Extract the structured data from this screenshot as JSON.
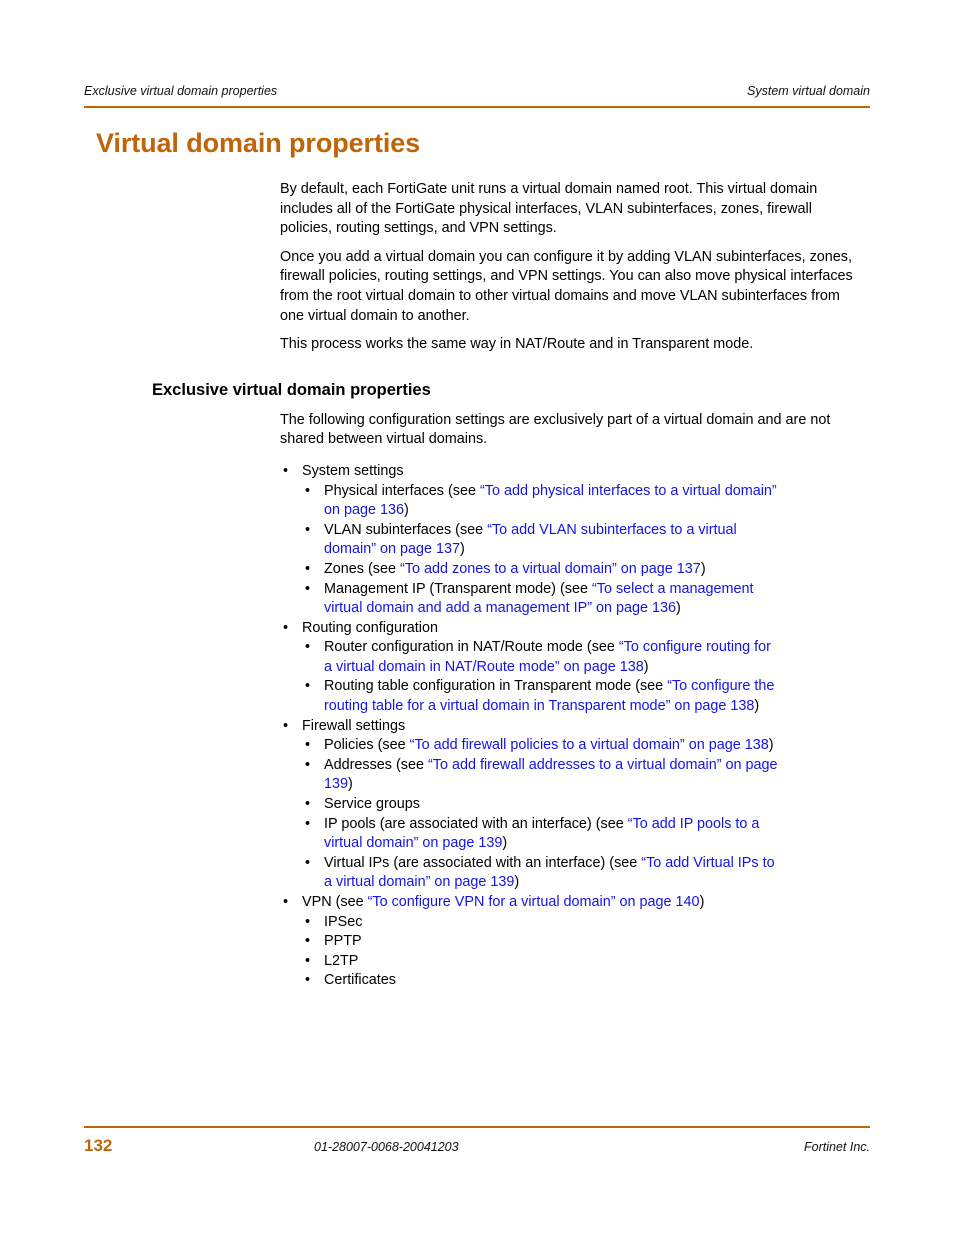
{
  "header": {
    "left": "Exclusive virtual domain properties",
    "right": "System virtual domain"
  },
  "title": "Virtual domain properties",
  "intro_paragraphs": [
    "By default, each FortiGate unit runs a virtual domain named root. This virtual domain includes all of the FortiGate physical interfaces, VLAN subinterfaces, zones, firewall policies, routing settings, and VPN settings.",
    "Once you add a virtual domain you can configure it by adding VLAN subinterfaces, zones, firewall policies, routing settings, and VPN settings. You can also move physical interfaces from the root virtual domain to other virtual domains and move VLAN subinterfaces from one virtual domain to another.",
    "This process works the same way in NAT/Route and in Transparent mode."
  ],
  "section": {
    "heading": "Exclusive virtual domain properties",
    "lead": "The following configuration settings are exclusively part of a virtual domain and are not shared between virtual domains.",
    "bullet_char": "•",
    "groups": [
      {
        "label": "System settings",
        "items": [
          {
            "pre": "Physical interfaces (see ",
            "link": "“To add physical interfaces to a virtual domain” on page 136",
            "post": ")"
          },
          {
            "pre": "VLAN subinterfaces (see ",
            "link": "“To add VLAN subinterfaces to a virtual domain” on page 137",
            "post": ")"
          },
          {
            "pre": "Zones (see ",
            "link": "“To add zones to a virtual domain” on page 137",
            "post": ")"
          },
          {
            "pre": "Management IP (Transparent mode) (see ",
            "link": "“To select a management virtual domain and add a management IP” on page 136",
            "post": ")"
          }
        ]
      },
      {
        "label": "Routing configuration",
        "items": [
          {
            "pre": "Router configuration in NAT/Route mode (see ",
            "link": "“To configure routing for a virtual domain in NAT/Route mode” on page 138",
            "post": ")"
          },
          {
            "pre": "Routing table configuration in Transparent mode (see ",
            "link": "“To configure the routing table for a virtual domain in Transparent mode” on page 138",
            "post": ")"
          }
        ]
      },
      {
        "label": "Firewall settings",
        "items": [
          {
            "pre": "Policies (see ",
            "link": "“To add firewall policies to a virtual domain” on page 138",
            "post": ")"
          },
          {
            "pre": "Addresses (see ",
            "link": "“To add firewall addresses to a virtual domain” on page 139",
            "post": ")"
          },
          {
            "pre": "Service groups",
            "link": "",
            "post": ""
          },
          {
            "pre": "IP pools (are associated with an interface) (see ",
            "link": "“To add IP pools to a virtual domain” on page 139",
            "post": ")"
          },
          {
            "pre": "Virtual IPs (are associated with an interface) (see ",
            "link": "“To add Virtual IPs to a virtual domain” on page 139",
            "post": ")"
          }
        ]
      },
      {
        "label_pre": "VPN (see ",
        "label_link": "“To configure VPN for a virtual domain” on page 140",
        "label_post": ")",
        "items": [
          {
            "pre": "IPSec",
            "link": "",
            "post": ""
          },
          {
            "pre": "PPTP",
            "link": "",
            "post": ""
          },
          {
            "pre": "L2TP",
            "link": "",
            "post": ""
          },
          {
            "pre": "Certificates",
            "link": "",
            "post": ""
          }
        ]
      }
    ]
  },
  "footer": {
    "page_number": "132",
    "document_number": "01-28007-0068-20041203",
    "company": "Fortinet Inc."
  },
  "colors": {
    "accent_orange": "#c06408",
    "link_blue": "#1414e6",
    "text_black": "#000000"
  }
}
